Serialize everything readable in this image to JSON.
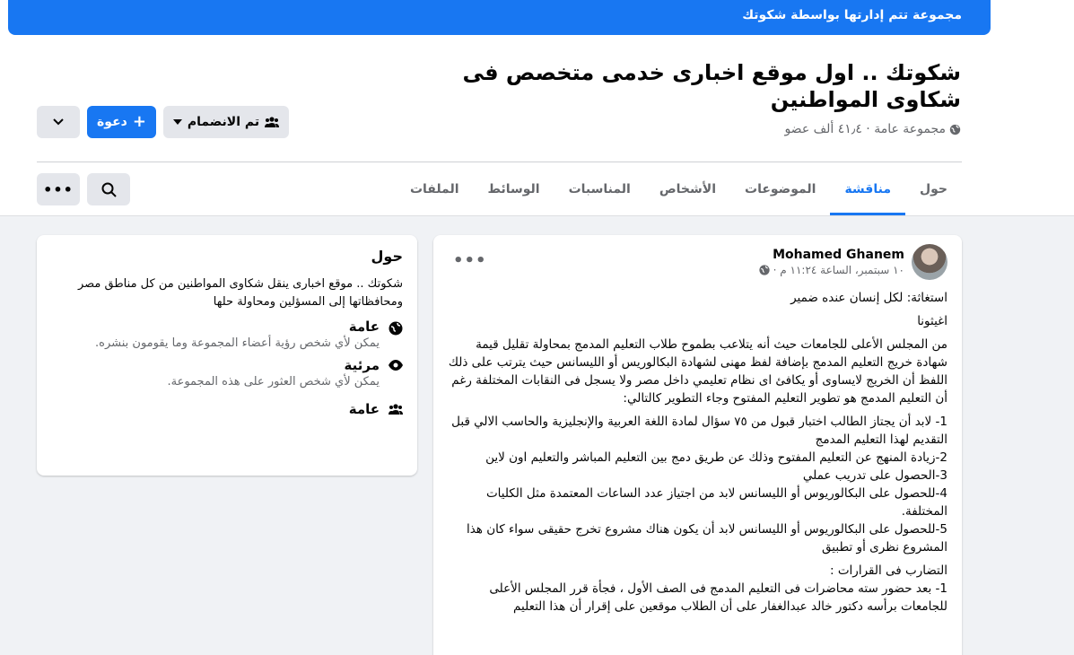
{
  "banner": {
    "text": "مجموعة تتم إدارتها بواسطة شكوتك"
  },
  "group": {
    "title": "شكوتك .. اول موقع اخبارى خدمى متخصص فى شكاوى المواطنين",
    "meta": "مجموعة عامة · ٤١٫٤ ألف عضو"
  },
  "actions": {
    "joined_label": "تم الانضمام",
    "invite_label": "دعوة"
  },
  "tabs": [
    "حول",
    "مناقشة",
    "الموضوعات",
    "الأشخاص",
    "المناسبات",
    "الوسائط",
    "الملفات"
  ],
  "active_tab": 1,
  "about": {
    "title": "حول",
    "description": "شكوتك .. موقع اخبارى ينقل شكاوى المواطنين من كل مناطق مصر ومحافظاتها إلى المسؤلين ومحاولة حلها",
    "public_title": "عامة",
    "public_desc": "يمكن لأي شخص رؤية أعضاء المجموعة وما يقومون بنشره.",
    "visible_title": "مرئية",
    "visible_desc": "يمكن لأي شخص العثور على هذه المجموعة.",
    "general_title": "عامة"
  },
  "post": {
    "author": "Mohamed Ghanem",
    "time": "١٠ سبتمبر، الساعة ١١:٢٤ م ·",
    "paragraphs": [
      "استغاثة: لكل إنسان عنده ضمير",
      "اغيثونا",
      "من المجلس الأعلى للجامعات حيث أنه يتلاعب بطموح طلاب التعليم المدمج بمحاولة تقليل قيمة شهادة خريج التعليم المدمج بإضافة لفظ مهنى لشهادة البكالوريس أو الليسانس حيث يترتب على ذلك اللفظ أن الخريج لايساوى أو يكافئ اى نظام تعليمي داخل مصر ولا يسجل فى النقابات المختلفة رغم أن التعليم المدمج هو تطوير التعليم المفتوح وجاء التطوير كالتالي:",
      "1- لابد أن يجتاز الطالب اختبار قبول من ٧٥ سؤال لمادة اللغة العربية والإنجليزية والحاسب الالي قبل التقديم لهذا التعليم المدمج\n2-زيادة المنهج عن التعليم المفتوح وذلك عن طريق دمج بين التعليم المباشر والتعليم اون لاين\n3-الحصول على تدريب عملي\n4-للحصول على البكالوريوس أو الليسانس لابد من اجتياز عدد الساعات المعتمدة مثل الكليات المختلفة.\n5-للحصول على البكالوريوس أو الليسانس لابد أن يكون هناك مشروع تخرج حقيقى سواء كان هذا المشروع نظرى أو تطبيق",
      "التضارب فى القرارات :\n1- بعد حضور سته محاضرات فى التعليم المدمج فى الصف الأول ، فجأة قرر المجلس الأعلى للجامعات برأسه دكتور خالد عبدالغفار على أن الطلاب موقعين على إقرار أن هذا التعليم"
    ]
  },
  "colors": {
    "accent": "#1877f2",
    "muted": "#65676b",
    "background": "#f0f2f5"
  }
}
